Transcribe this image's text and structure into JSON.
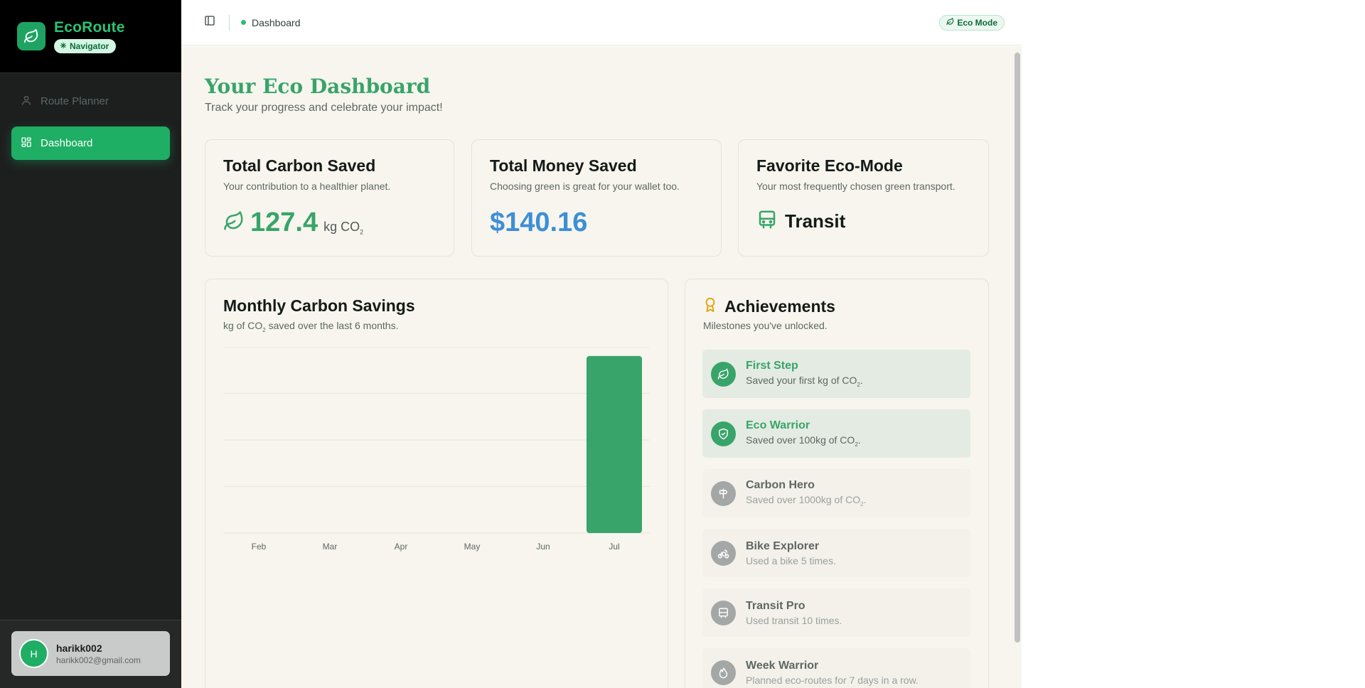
{
  "brand": {
    "name": "EcoRoute",
    "badge": "Navigator"
  },
  "sidebar": {
    "items": [
      {
        "label": "Route Planner",
        "icon": "user-icon"
      },
      {
        "label": "Dashboard",
        "icon": "grid-icon"
      }
    ]
  },
  "user": {
    "initial": "H",
    "name": "harikk002",
    "email": "harikk002@gmail.com"
  },
  "topbar": {
    "breadcrumb": "Dashboard",
    "mode_pill": "Eco Mode"
  },
  "page": {
    "title": "Your Eco Dashboard",
    "subtitle": "Track your progress and celebrate your impact!"
  },
  "stats": {
    "carbon": {
      "title": "Total Carbon Saved",
      "desc": "Your contribution to a healthier planet.",
      "value": "127.4",
      "unit": "kg CO",
      "unit_sub": "2"
    },
    "money": {
      "title": "Total Money Saved",
      "desc": "Choosing green is great for your wallet too.",
      "value": "$140.16"
    },
    "mode": {
      "title": "Favorite Eco-Mode",
      "desc": "Your most frequently chosen green transport.",
      "value": "Transit"
    }
  },
  "chart_section": {
    "title": "Monthly Carbon Savings",
    "desc_prefix": "kg of CO",
    "desc_sub": "2",
    "desc_suffix": " saved over the last 6 months."
  },
  "chart_data": {
    "type": "bar",
    "categories": [
      "Feb",
      "Mar",
      "Apr",
      "May",
      "Jun",
      "Jul"
    ],
    "values": [
      0,
      0,
      0,
      0,
      0,
      127.4
    ],
    "title": "Monthly Carbon Savings",
    "ylim": [
      0,
      134
    ],
    "grid": true,
    "bar_color": "#38a46a"
  },
  "achievements": {
    "title": "Achievements",
    "desc": "Milestones you've unlocked.",
    "items": [
      {
        "name": "First Step",
        "desc": "Saved your first kg of CO",
        "sub": "2",
        "tail": ".",
        "icon": "leaf-icon",
        "unlocked": true
      },
      {
        "name": "Eco Warrior",
        "desc": "Saved over 100kg of CO",
        "sub": "2",
        "tail": ".",
        "icon": "shield-icon",
        "unlocked": true
      },
      {
        "name": "Carbon Hero",
        "desc": "Saved over 1000kg of CO",
        "sub": "2",
        "tail": ".",
        "icon": "signpost-icon",
        "unlocked": false
      },
      {
        "name": "Bike Explorer",
        "desc": "Used a bike 5 times.",
        "sub": "",
        "tail": "",
        "icon": "bike-icon",
        "unlocked": false
      },
      {
        "name": "Transit Pro",
        "desc": "Used transit 10 times.",
        "sub": "",
        "tail": "",
        "icon": "bus-icon",
        "unlocked": false
      },
      {
        "name": "Week Warrior",
        "desc": "Planned eco-routes for 7 days in a row.",
        "sub": "",
        "tail": "",
        "icon": "flame-icon",
        "unlocked": false
      }
    ]
  },
  "colors": {
    "accent": "#1eae64",
    "green_text": "#38a46a",
    "blue_value": "#3d8fd6",
    "background": "#f7f5ee"
  }
}
